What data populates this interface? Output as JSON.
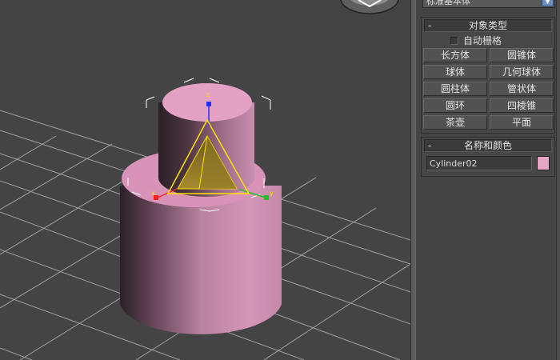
{
  "command_panel": {
    "category_dropdown": "标准基本体",
    "object_type": {
      "title": "对象类型",
      "collapse_symbol": "-",
      "autogrid_label": "自动栅格",
      "autogrid_checked": false,
      "buttons": [
        "长方体",
        "圆锥体",
        "球体",
        "几何球体",
        "圆柱体",
        "管状体",
        "圆环",
        "四棱锥",
        "茶壶",
        "平面"
      ]
    },
    "name_color": {
      "title": "名称和颜色",
      "collapse_symbol": "-",
      "object_name": "Cylinder02",
      "object_color": "#e6a6c6"
    }
  },
  "viewport": {
    "gizmo_axes": {
      "x": "x",
      "y": "y",
      "z": "z"
    },
    "object_color": "#d98fb6",
    "axis_colors": {
      "x": "#ff2020",
      "y": "#20c020",
      "z": "#2030ff",
      "gizmo": "#ffe000"
    }
  }
}
